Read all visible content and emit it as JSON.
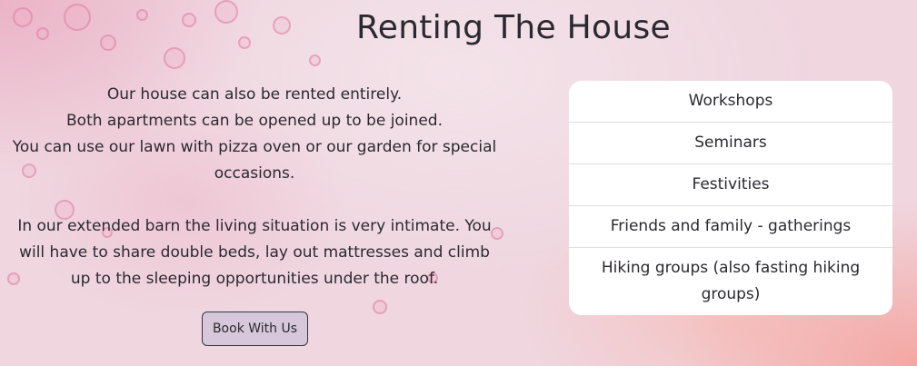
{
  "section": {
    "title": "Renting The House"
  },
  "description": {
    "paragraph_1_line_1": "Our house can also be rented entirely.",
    "paragraph_1_line_2": "Both apartments can be opened up to be joined.",
    "paragraph_1_line_3": "You can use our lawn with pizza oven or our garden for special occasions.",
    "paragraph_2": "In our extended barn the living situation is very intimate. You will have to share double beds, lay out mattresses and climb up to the sleeping opportunities under the roof."
  },
  "cta": {
    "book_label": "Book With Us"
  },
  "occasions": {
    "items": [
      "Workshops",
      "Seminars",
      "Festivities",
      "Friends and family - gatherings",
      "Hiking groups (also fasting hiking groups)"
    ]
  },
  "colors": {
    "button_background": "#d6c7db",
    "list_background": "#ffffff",
    "text": "#2b2930"
  }
}
